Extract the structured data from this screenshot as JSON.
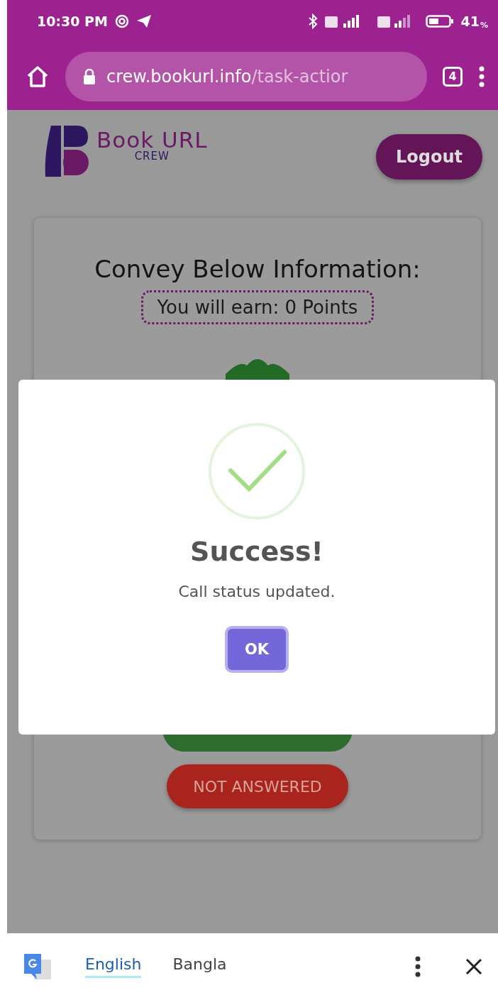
{
  "status_bar": {
    "time": "10:30 PM",
    "battery": "41",
    "battery_unit": "%"
  },
  "browser": {
    "url_host": "crew.bookurl.info",
    "url_path": "/task-actior",
    "tab_count": "4"
  },
  "header": {
    "brand": "Book URL",
    "brand_sub": "CREW",
    "logout": "Logout"
  },
  "card": {
    "title": "Convey Below Information:",
    "points": "You will earn: 0 Points",
    "buttons": [
      {
        "kind": "answered"
      },
      {
        "kind": "not_answered",
        "label": "NOT ANSWERED"
      }
    ]
  },
  "dialog": {
    "title": "Success!",
    "message": "Call status updated.",
    "button": "OK"
  },
  "translate_bar": {
    "languages": [
      {
        "label": "English",
        "selected": true
      },
      {
        "label": "Bangla",
        "selected": false
      }
    ]
  }
}
